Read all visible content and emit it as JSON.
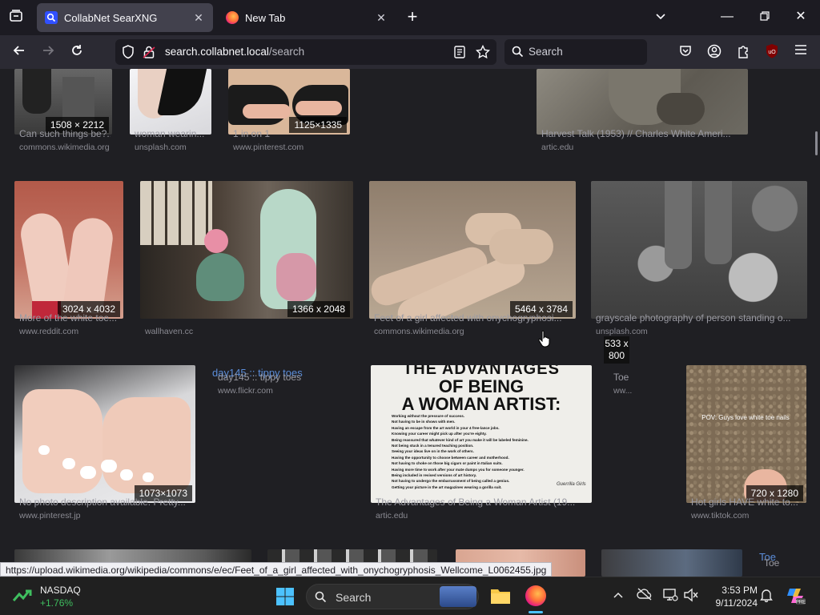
{
  "tabs": [
    {
      "title": "CollabNet SearXNG",
      "active": true
    },
    {
      "title": "New Tab",
      "active": false
    }
  ],
  "url": {
    "host": "search.collabnet.local",
    "path": "/search"
  },
  "search_placeholder": "Search",
  "results_row0": [
    {
      "title": "Can such things be?...",
      "source": "commons.wikimedia.org",
      "dim": "1508 × 2212"
    },
    {
      "title": "woman wearin...",
      "source": "unsplash.com",
      "dim": ""
    },
    {
      "title": "1 in on 1",
      "source": "www.pinterest.com",
      "dim": "1125×1335"
    },
    {
      "title": "Harvest Talk (1953) // Charles White Ameri...",
      "source": "artic.edu",
      "dim": ""
    }
  ],
  "results_row1": [
    {
      "title": "More of the white toe...",
      "source": "www.reddit.com",
      "dim": "3024 x 4032"
    },
    {
      "title": "",
      "source": "wallhaven.cc",
      "dim": "1366 x 2048"
    },
    {
      "title": "Feet of a girl affected with onychogryphosi...",
      "source": "commons.wikimedia.org",
      "dim": "5464 x 3784"
    },
    {
      "title": "grayscale photography of person standing o...",
      "source": "unsplash.com",
      "dim": ""
    }
  ],
  "results_row2": [
    {
      "title": "No photo description available. Pretty...",
      "source": "www.pinterest.jp",
      "dim": "1073×1073"
    },
    {
      "title": "day145 :: tippy toes",
      "source": "www.flickr.com",
      "dim": "",
      "overlay": "day145 :: tippy toes"
    },
    {
      "title": "The Advantages of Being a Woman Artist (19...",
      "source": "artic.edu",
      "dim": ""
    },
    {
      "title": "Toe",
      "source": "ww...",
      "dim": "533 x 800"
    },
    {
      "title": "Hot girls HAVE white to...",
      "source": "www.tiktok.com",
      "dim": "720 x 1280",
      "caption": "POV: Guys love white toe nails"
    }
  ],
  "poster": {
    "headline1": "THE ADVANTAGES",
    "headline2": "OF BEING",
    "headline3": "A WOMAN ARTIST:",
    "lines": [
      "Working without the pressure of success.",
      "Not having to be in shows with men.",
      "Having an escape from the art world in your 4 free-lance jobs.",
      "Knowing your career might pick up after you're eighty.",
      "Being reassured that whatever kind of art you make it will be labeled feminine.",
      "Not being stuck in a tenured teaching position.",
      "Seeing your ideas live on in the work of others.",
      "Having the opportunity to choose between career and motherhood.",
      "Not having to choke on those big cigars or paint in Italian suits.",
      "Having more time to work after your mate dumps you for someone younger.",
      "Being included in revised versions of art history.",
      "Not having to undergo the embarrassment of being called a genius.",
      "Getting your picture in the art magazines wearing a gorilla suit."
    ],
    "signature": "Guerrilla Girls"
  },
  "row3_label": "Toe",
  "row3_label2": "Toe",
  "status_link": "https://upload.wikimedia.org/wikipedia/commons/e/ec/Feet_of_a_girl_affected_with_onychogryphosis_Wellcome_L0062455.jpg",
  "taskbar": {
    "stock_name": "NASDAQ",
    "stock_change": "+1.76%",
    "search_label": "Search",
    "time": "3:53 PM",
    "date": "9/11/2024"
  }
}
